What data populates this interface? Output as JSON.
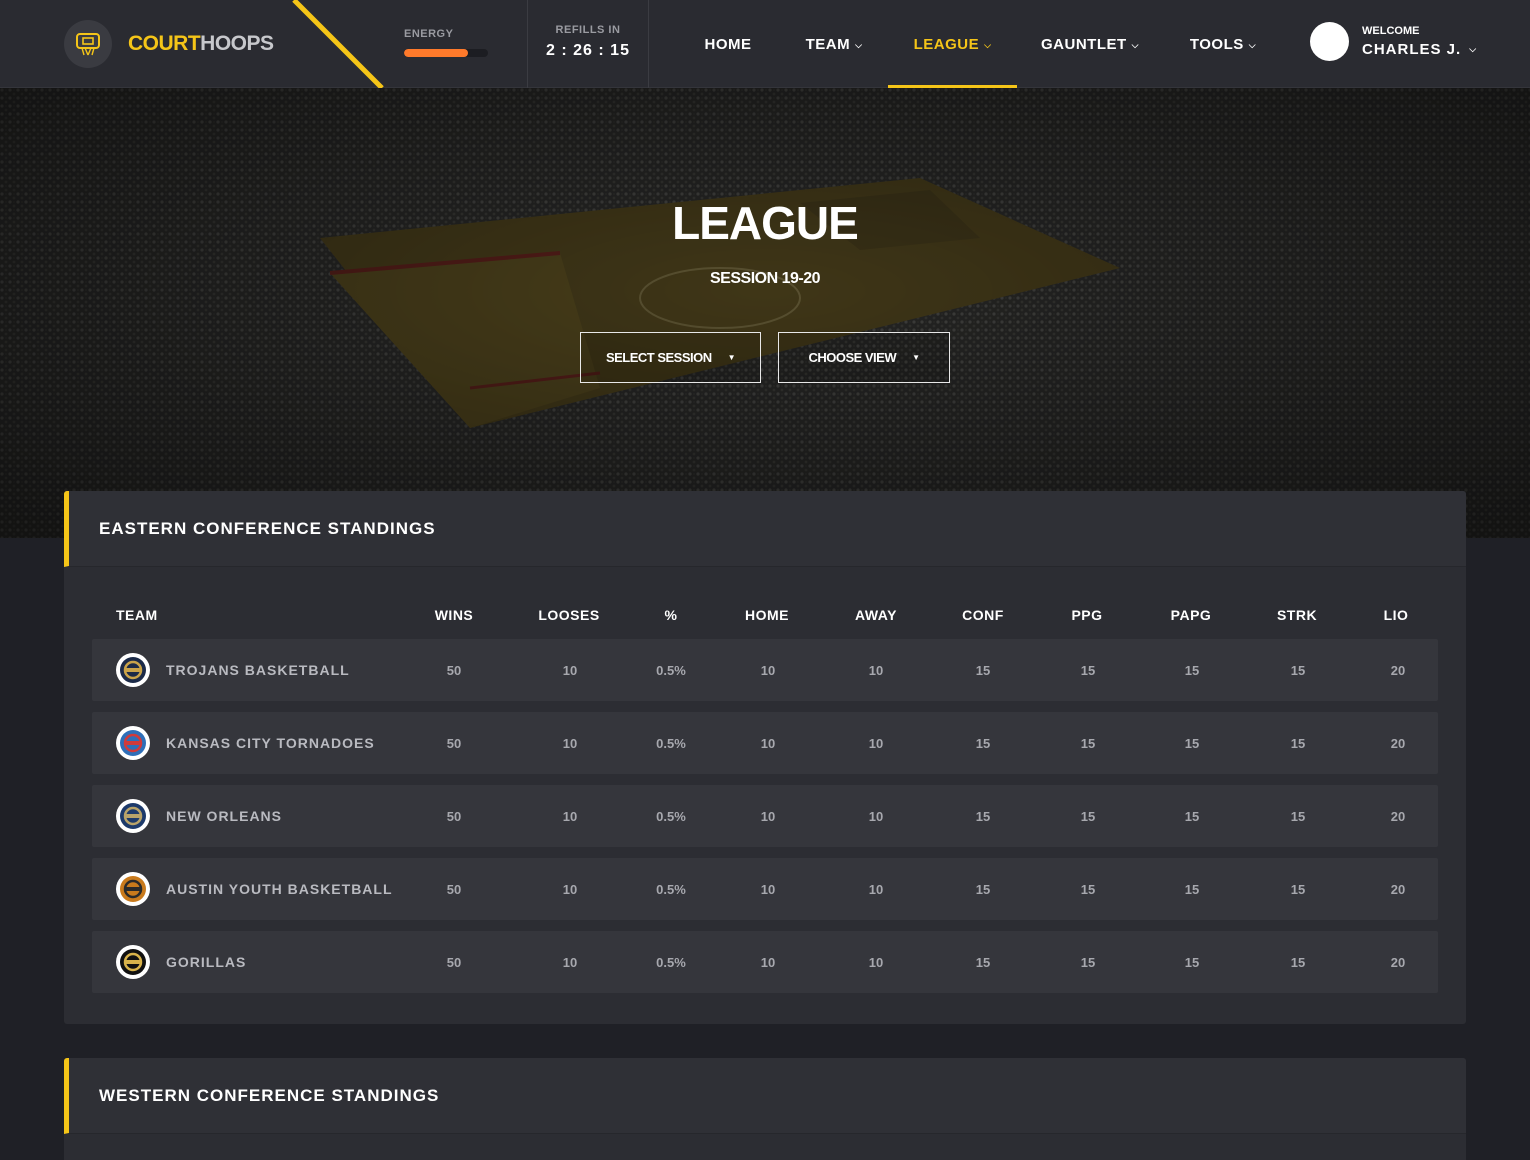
{
  "header": {
    "brand": {
      "part1": "COURT",
      "part2": "HOOPS"
    },
    "energy": {
      "label": "ENERGY",
      "level_percent": 76
    },
    "refills": {
      "label": "REFILLS IN",
      "timer": "2 : 26 : 15"
    },
    "nav": [
      {
        "label": "HOME",
        "has_dropdown": false,
        "active": false
      },
      {
        "label": "TEAM",
        "has_dropdown": true,
        "active": false
      },
      {
        "label": "LEAGUE",
        "has_dropdown": true,
        "active": true
      },
      {
        "label": "GAUNTLET",
        "has_dropdown": true,
        "active": false
      },
      {
        "label": "TOOLS",
        "has_dropdown": true,
        "active": false
      }
    ],
    "user": {
      "welcome": "WELCOME",
      "name": "CHARLES J."
    }
  },
  "hero": {
    "title": "LEAGUE",
    "subtitle": "SESSION 19-20",
    "select_session": "SELECT SESSION",
    "choose_view": "CHOOSE VIEW"
  },
  "eastern": {
    "title": "EASTERN CONFERENCE STANDINGS",
    "columns": [
      "TEAM",
      "WINS",
      "LOOSES",
      "%",
      "HOME",
      "AWAY",
      "CONF",
      "PPG",
      "PAPG",
      "STRK",
      "LIO"
    ],
    "rows": [
      {
        "team": "TROJANS BASKETBALL",
        "logo": "trojans-logo",
        "values": [
          "50",
          "10",
          "0.5%",
          "10",
          "10",
          "15",
          "15",
          "15",
          "15",
          "20"
        ]
      },
      {
        "team": "KANSAS CITY TORNADOES",
        "logo": "tornadoes-logo",
        "values": [
          "50",
          "10",
          "0.5%",
          "10",
          "10",
          "15",
          "15",
          "15",
          "15",
          "20"
        ]
      },
      {
        "team": "NEW ORLEANS",
        "logo": "new-orleans-logo",
        "values": [
          "50",
          "10",
          "0.5%",
          "10",
          "10",
          "15",
          "15",
          "15",
          "15",
          "20"
        ]
      },
      {
        "team": "AUSTIN YOUTH BASKETBALL",
        "logo": "austin-youth-logo",
        "values": [
          "50",
          "10",
          "0.5%",
          "10",
          "10",
          "15",
          "15",
          "15",
          "15",
          "20"
        ]
      },
      {
        "team": "GORILLAS",
        "logo": "gorillas-logo",
        "values": [
          "50",
          "10",
          "0.5%",
          "10",
          "10",
          "15",
          "15",
          "15",
          "15",
          "20"
        ]
      }
    ]
  },
  "western": {
    "title": "WESTERN CONFERENCE STANDINGS"
  },
  "colors": {
    "accent": "#f5c518",
    "energy": "#ff7a2b",
    "background": "#1f2026",
    "panel": "#2c2d33",
    "row": "#35363c"
  }
}
